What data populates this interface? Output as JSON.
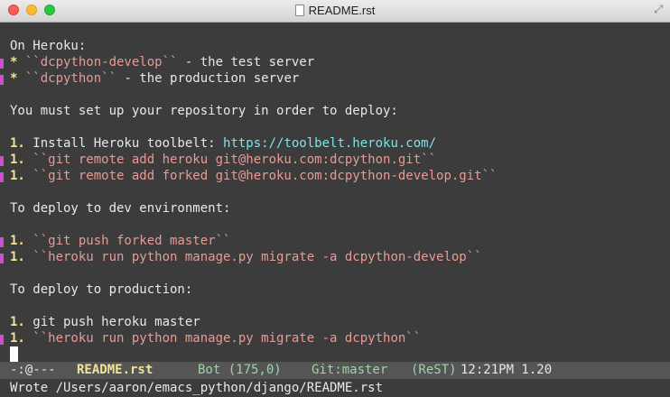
{
  "window": {
    "title": "README.rst"
  },
  "buffer": {
    "l1": "On Heroku:",
    "l2_bullet": "* ",
    "l2_code": "``dcpython-develop``",
    "l2_rest": " - the test server",
    "l3_bullet": "* ",
    "l3_code": "``dcpython``",
    "l3_rest": " - the production server",
    "l5": "You must set up your repository in order to deploy:",
    "l7_num": "1.",
    "l7_text": " Install Heroku toolbelt: ",
    "l7_link": "https://toolbelt.heroku.com/",
    "l8_num": "1.",
    "l8_code": " ``git remote add heroku git@heroku.com:dcpython.git``",
    "l9_num": "1.",
    "l9_code": " ``git remote add forked git@heroku.com:dcpython-develop.git``",
    "l11": "To deploy to dev environment:",
    "l13_num": "1.",
    "l13_code": " ``git push forked master``",
    "l14_num": "1.",
    "l14_code": " ``heroku run python manage.py migrate -a dcpython-develop``",
    "l16": "To deploy to production:",
    "l18_num": "1.",
    "l18_text": " git push heroku master",
    "l19_num": "1.",
    "l19_code": " ``heroku run python manage.py migrate -a dcpython``"
  },
  "modeline": {
    "status": "-:@---",
    "filename": "README.rst",
    "position": "Bot (175,0)",
    "vc": "Git:master",
    "mode": "(ReST)",
    "time": "12:21PM 1.20"
  },
  "echo_area": "Wrote /Users/aaron/emacs_python/django/README.rst"
}
